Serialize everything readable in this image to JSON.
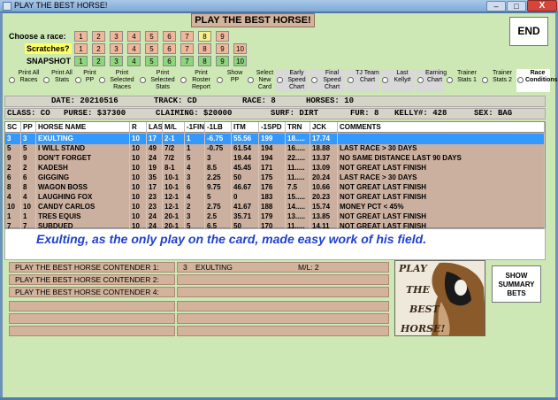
{
  "window": {
    "title": "PLAY THE BEST HORSE!",
    "min_glyph": "–",
    "max_glyph": "□",
    "close_glyph": "X"
  },
  "app": {
    "title": "PLAY THE BEST HORSE!",
    "end_label": "END"
  },
  "race_picker": {
    "choose_label": "Choose a race:",
    "scratch_label": "Scratches?",
    "snapshot_label": "SNAPSHOT",
    "choose_nums": [
      "1",
      "2",
      "3",
      "4",
      "5",
      "6",
      "7",
      "8",
      "9"
    ],
    "scratch_nums": [
      "1",
      "2",
      "3",
      "4",
      "5",
      "6",
      "7",
      "8",
      "9",
      "10"
    ],
    "snapshot_nums": [
      "1",
      "2",
      "3",
      "4",
      "5",
      "6",
      "7",
      "8",
      "9",
      "10"
    ],
    "selected_race": "8",
    "colors": {
      "race": "#f1b79c",
      "selected": "#f5f08a",
      "snapshot": "#8dd67b"
    }
  },
  "options": [
    {
      "label": "Print All Races"
    },
    {
      "label": "Print All Stats"
    },
    {
      "label": "Print PP"
    },
    {
      "label": "Print Selected Races"
    },
    {
      "label": "Print Selected Stats"
    },
    {
      "label": "Print Roster Report"
    },
    {
      "label": "Show PP"
    },
    {
      "label": "Select New Card"
    },
    {
      "label": "Early Speed Chart"
    },
    {
      "label": "Final Speed Chart"
    },
    {
      "label": "TJ Team Chart"
    },
    {
      "label": "Last Kelly#"
    },
    {
      "label": "Earning Chart"
    },
    {
      "label": "Trainer Stats 1"
    },
    {
      "label": "Trainer Stats 2"
    },
    {
      "label": "Race Conditions"
    }
  ],
  "race_info": {
    "date": "DATE: 20210516",
    "track": "TRACK: CD",
    "race": "RACE: 8",
    "horses": "HORSES: 10",
    "class": "CLASS: CO",
    "purse": "PURSE: $37300",
    "claiming": "CLAIMING: $20000",
    "surf": "SURF: DIRT",
    "fur": "FUR: 8",
    "kelly": "KELLY#: 428",
    "sex": "SEX: BAG"
  },
  "table": {
    "columns": [
      "SC",
      "PP",
      "HORSE NAME",
      "R",
      "LAST",
      "M/L",
      "-1FIN",
      "-1LB",
      "ITM",
      "-1SPD",
      "TRN",
      "JCK",
      "COMMENTS"
    ],
    "rows": [
      [
        "3",
        "3",
        "EXULTING",
        "10",
        "17",
        "2-1",
        "1",
        "-6.75",
        "55.56",
        "199",
        "18.....",
        "17.74",
        ""
      ],
      [
        "5",
        "5",
        "I WILL STAND",
        "10",
        "49",
        "7/2",
        "1",
        "-0.75",
        "61.54",
        "194",
        "16.....",
        "18.88",
        "LAST RACE > 30 DAYS"
      ],
      [
        "9",
        "9",
        "DON'T FORGET",
        "10",
        "24",
        "7/2",
        "5",
        "3",
        "19.44",
        "194",
        "22.....",
        "13.37",
        "NO SAME DISTANCE LAST 90 DAYS"
      ],
      [
        "2",
        "2",
        "KADESH",
        "10",
        "19",
        "8-1",
        "4",
        "8.5",
        "45.45",
        "171",
        "11.....",
        "13.09",
        "NOT GREAT LAST FINISH"
      ],
      [
        "6",
        "6",
        "GIGGING",
        "10",
        "35",
        "10-1",
        "3",
        "2.25",
        "50",
        "175",
        "11.....",
        "20.24",
        "LAST RACE > 30 DAYS"
      ],
      [
        "8",
        "8",
        "WAGON BOSS",
        "10",
        "17",
        "10-1",
        "6",
        "9.75",
        "46.67",
        "176",
        "7.5",
        "10.66",
        "NOT GREAT LAST FINISH"
      ],
      [
        "4",
        "4",
        "LAUGHING FOX",
        "10",
        "23",
        "12-1",
        "4",
        "5",
        "0",
        "183",
        "15.....",
        "20.23",
        "NOT GREAT LAST FINISH"
      ],
      [
        "10",
        "10",
        "CANDY CARLOS",
        "10",
        "23",
        "12-1",
        "2",
        "2.75",
        "41.67",
        "188",
        "14.....",
        "15.74",
        "MONEY PCT < 45%"
      ],
      [
        "1",
        "1",
        "TRES EQUIS",
        "10",
        "24",
        "20-1",
        "3",
        "2.5",
        "35.71",
        "179",
        "13.....",
        "13.85",
        "NOT GREAT LAST FINISH"
      ],
      [
        "7",
        "7",
        "SUBDUED",
        "10",
        "24",
        "20-1",
        "5",
        "6.5",
        "50",
        "170",
        "11.....",
        "14.11",
        "NOT GREAT LAST FINISH"
      ]
    ],
    "selected_row": 0
  },
  "tagline": "Exulting, as the only play on the card, made easy work of his field.",
  "contenders": [
    {
      "label": "PLAY THE BEST HORSE CONTENDER 1:",
      "pp": "3",
      "name": "EXULTING",
      "ml": "M/L: 2"
    },
    {
      "label": "PLAY THE BEST HORSE CONTENDER 2:",
      "pp": "",
      "name": "",
      "ml": ""
    },
    {
      "label": "PLAY THE BEST HORSE CONTENDER 4:",
      "pp": "",
      "name": "",
      "ml": ""
    }
  ],
  "logo": {
    "line1": "PLAY",
    "line2": "THE",
    "line3": "BEST",
    "line4": "HORSE!"
  },
  "summary_button": "SHOW SUMMARY BETS"
}
